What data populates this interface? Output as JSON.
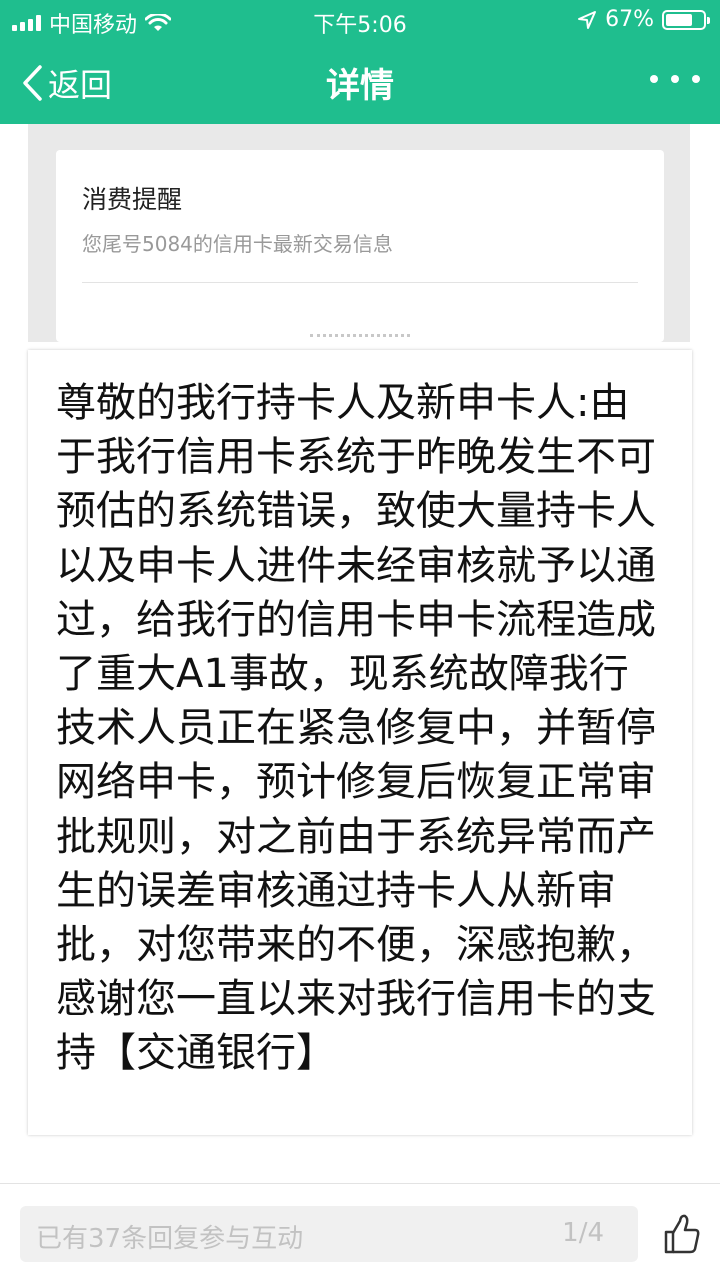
{
  "status_bar": {
    "carrier": "中国移动",
    "time": "下午5:06",
    "battery": "67%"
  },
  "nav": {
    "back_label": "返回",
    "title": "详情"
  },
  "notice_card": {
    "title": "消费提醒",
    "subtitle": "您尾号5084的信用卡最新交易信息"
  },
  "message": {
    "text": "尊敬的我行持卡人及新申卡人:由于我行信用卡系统于昨晚发生不可预估的系统错误，致使大量持卡人以及申卡人进件未经审核就予以通过，给我行的信用卡申卡流程造成了重大A1事故，现系统故障我行技术人员正在紧急修复中，并暂停网络申卡，预计修复后恢复正常审批规则，对之前由于系统异常而产生的误差审核通过持卡人从新审批，对您带来的不便，深感抱歉，感谢您一直以来对我行信用卡的支持【交通银行】"
  },
  "reply_bar": {
    "placeholder": "已有37条回复参与互动",
    "page": "1/4"
  },
  "colors": {
    "accent": "#1fbe8e"
  },
  "icons": [
    "signal-icon",
    "wifi-icon",
    "location-icon",
    "battery-icon",
    "back-chevron-icon",
    "more-icon",
    "thumbs-up-icon"
  ]
}
